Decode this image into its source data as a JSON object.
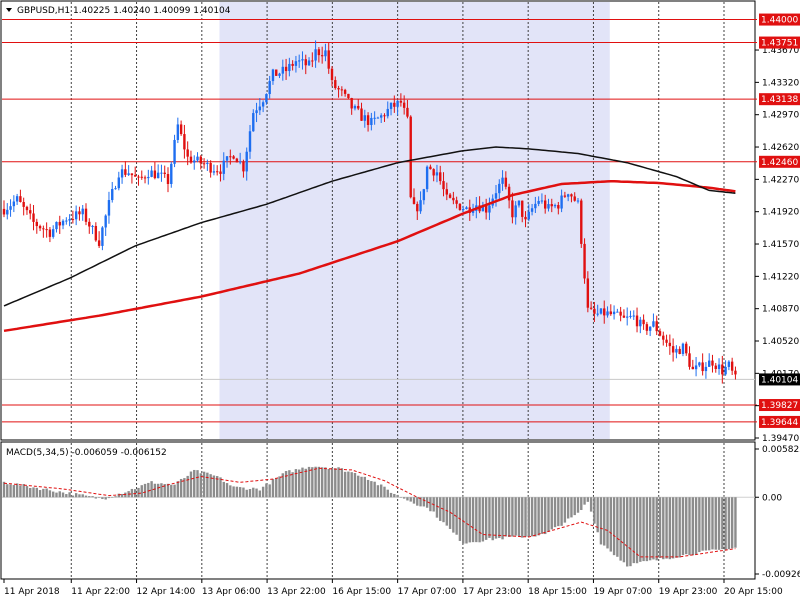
{
  "header": {
    "title": "GBPUSD,H1",
    "ohlc": "1.40225 1.40240 1.40099 1.40104",
    "macd_label": "MACD(5,34,5)",
    "macd_values": "-0.006059 -0.006152"
  },
  "colors": {
    "bull": "#1e6ef0",
    "bear": "#e01010",
    "ma_fast": "#111111",
    "ma_slow": "#e01010",
    "level": "#e01010",
    "shade": "#e2e4f8",
    "macd_hist": "#8c8c8c",
    "macd_signal": "#e01010"
  },
  "chart_data": [
    {
      "type": "candlestick",
      "symbol": "GBPUSD",
      "timeframe": "H1",
      "ylim": [
        1.3947,
        1.4419
      ],
      "yticks": [
        1.4367,
        1.4332,
        1.4297,
        1.4262,
        1.4227,
        1.4192,
        1.4157,
        1.4122,
        1.4087,
        1.4052,
        1.4017,
        1.3982,
        1.3947
      ],
      "ytick_labels": [
        "1.43670",
        "1.43320",
        "1.42970",
        "1.42620",
        "1.42270",
        "1.41920",
        "1.41570",
        "1.41220",
        "1.40870",
        "1.40520",
        "1.40170",
        "1.39820",
        "1.39470"
      ],
      "xtick_labels": [
        "11 Apr 2018",
        "11 Apr 22:00",
        "12 Apr 14:00",
        "13 Apr 06:00",
        "13 Apr 22:00",
        "16 Apr 15:00",
        "17 Apr 07:00",
        "17 Apr 23:00",
        "18 Apr 15:00",
        "19 Apr 07:00",
        "19 Apr 23:00",
        "20 Apr 15:00"
      ],
      "levels": [
        {
          "value": 1.44,
          "label": "1.44000"
        },
        {
          "value": 1.43751,
          "label": "1.43751"
        },
        {
          "value": 1.43138,
          "label": "1.43138"
        },
        {
          "value": 1.4246,
          "label": "1.42460"
        },
        {
          "value": 1.39827,
          "label": "1.39827"
        },
        {
          "value": 1.39644,
          "label": "1.39644"
        }
      ],
      "current_price": {
        "value": 1.40104,
        "label": "1.40104"
      },
      "shaded_range_bars": [
        66,
        185
      ],
      "anchors": [
        [
          0,
          1.4195
        ],
        [
          4,
          1.4205
        ],
        [
          9,
          1.418
        ],
        [
          14,
          1.417
        ],
        [
          19,
          1.4185
        ],
        [
          24,
          1.419
        ],
        [
          29,
          1.416
        ],
        [
          32,
          1.42
        ],
        [
          35,
          1.4235
        ],
        [
          38,
          1.4235
        ],
        [
          41,
          1.4225
        ],
        [
          44,
          1.4235
        ],
        [
          47,
          1.4232
        ],
        [
          50,
          1.4225
        ],
        [
          53,
          1.4285
        ],
        [
          56,
          1.425
        ],
        [
          60,
          1.4245
        ],
        [
          63,
          1.424
        ],
        [
          66,
          1.4238
        ],
        [
          70,
          1.4255
        ],
        [
          73,
          1.424
        ],
        [
          76,
          1.43
        ],
        [
          79,
          1.4315
        ],
        [
          82,
          1.434
        ],
        [
          86,
          1.4345
        ],
        [
          89,
          1.4355
        ],
        [
          93,
          1.435
        ],
        [
          95,
          1.4365
        ],
        [
          98,
          1.4365
        ],
        [
          100,
          1.433
        ],
        [
          103,
          1.432
        ],
        [
          106,
          1.4305
        ],
        [
          109,
          1.4295
        ],
        [
          112,
          1.4288
        ],
        [
          115,
          1.4295
        ],
        [
          118,
          1.4305
        ],
        [
          121,
          1.431
        ],
        [
          123,
          1.429
        ],
        [
          124,
          1.4205
        ],
        [
          125,
          1.4195
        ],
        [
          127,
          1.42
        ],
        [
          129,
          1.424
        ],
        [
          132,
          1.4235
        ],
        [
          135,
          1.4205
        ],
        [
          138,
          1.42
        ],
        [
          141,
          1.4195
        ],
        [
          144,
          1.42
        ],
        [
          147,
          1.4195
        ],
        [
          150,
          1.4215
        ],
        [
          152,
          1.4225
        ],
        [
          155,
          1.419
        ],
        [
          157,
          1.42
        ],
        [
          159,
          1.418
        ],
        [
          161,
          1.4195
        ],
        [
          163,
          1.4205
        ],
        [
          166,
          1.4195
        ],
        [
          169,
          1.42
        ],
        [
          172,
          1.4215
        ],
        [
          175,
          1.42
        ],
        [
          178,
          1.4085
        ],
        [
          180,
          1.408
        ],
        [
          183,
          1.4082
        ],
        [
          186,
          1.408
        ],
        [
          189,
          1.4075
        ],
        [
          192,
          1.4078
        ],
        [
          195,
          1.4065
        ],
        [
          198,
          1.407
        ],
        [
          201,
          1.4055
        ],
        [
          204,
          1.404
        ],
        [
          207,
          1.4045
        ],
        [
          210,
          1.402
        ],
        [
          213,
          1.4025
        ],
        [
          216,
          1.403
        ],
        [
          219,
          1.402
        ],
        [
          221,
          1.4025
        ],
        [
          223,
          1.401
        ]
      ],
      "ma_fast": [
        [
          0,
          1.409
        ],
        [
          20,
          1.412
        ],
        [
          40,
          1.4155
        ],
        [
          60,
          1.418
        ],
        [
          80,
          1.42
        ],
        [
          100,
          1.4225
        ],
        [
          120,
          1.4245
        ],
        [
          140,
          1.4258
        ],
        [
          150,
          1.4262
        ],
        [
          160,
          1.426
        ],
        [
          175,
          1.4255
        ],
        [
          190,
          1.4245
        ],
        [
          205,
          1.423
        ],
        [
          215,
          1.4215
        ],
        [
          223,
          1.4212
        ]
      ],
      "ma_slow": [
        [
          0,
          1.4063
        ],
        [
          30,
          1.408
        ],
        [
          60,
          1.41
        ],
        [
          90,
          1.4125
        ],
        [
          120,
          1.416
        ],
        [
          140,
          1.419
        ],
        [
          155,
          1.421
        ],
        [
          170,
          1.4222
        ],
        [
          185,
          1.4225
        ],
        [
          200,
          1.4223
        ],
        [
          215,
          1.4218
        ],
        [
          223,
          1.4214
        ]
      ]
    },
    {
      "type": "bar",
      "name": "MACD(5,34,5)",
      "ylim": [
        -0.009265,
        0.005825
      ],
      "ytick_labels": [
        "0.005825",
        "0.00",
        "-0.009265"
      ],
      "hist_anchors": [
        [
          0,
          0.0018
        ],
        [
          15,
          0.0008
        ],
        [
          30,
          -0.0002
        ],
        [
          38,
          0.0008
        ],
        [
          45,
          0.0018
        ],
        [
          52,
          0.0015
        ],
        [
          58,
          0.0032
        ],
        [
          65,
          0.0025
        ],
        [
          70,
          0.0012
        ],
        [
          78,
          0.001
        ],
        [
          86,
          0.003
        ],
        [
          94,
          0.0038
        ],
        [
          102,
          0.0035
        ],
        [
          110,
          0.0025
        ],
        [
          120,
          0.0002
        ],
        [
          130,
          -0.0015
        ],
        [
          140,
          -0.0055
        ],
        [
          150,
          -0.005
        ],
        [
          165,
          -0.0045
        ],
        [
          175,
          -0.002
        ],
        [
          178,
          -0.0005
        ],
        [
          182,
          -0.0055
        ],
        [
          190,
          -0.0082
        ],
        [
          200,
          -0.0075
        ],
        [
          210,
          -0.0068
        ],
        [
          223,
          -0.0061
        ]
      ],
      "signal_anchors": [
        [
          0,
          0.0017
        ],
        [
          18,
          0.001
        ],
        [
          32,
          0.0002
        ],
        [
          42,
          0.0005
        ],
        [
          50,
          0.0015
        ],
        [
          60,
          0.0025
        ],
        [
          72,
          0.0018
        ],
        [
          82,
          0.0022
        ],
        [
          96,
          0.0035
        ],
        [
          106,
          0.0033
        ],
        [
          116,
          0.002
        ],
        [
          126,
          0.0
        ],
        [
          136,
          -0.0018
        ],
        [
          146,
          -0.0045
        ],
        [
          160,
          -0.0048
        ],
        [
          176,
          -0.003
        ],
        [
          184,
          -0.004
        ],
        [
          194,
          -0.0072
        ],
        [
          206,
          -0.0072
        ],
        [
          223,
          -0.0062
        ]
      ]
    }
  ]
}
